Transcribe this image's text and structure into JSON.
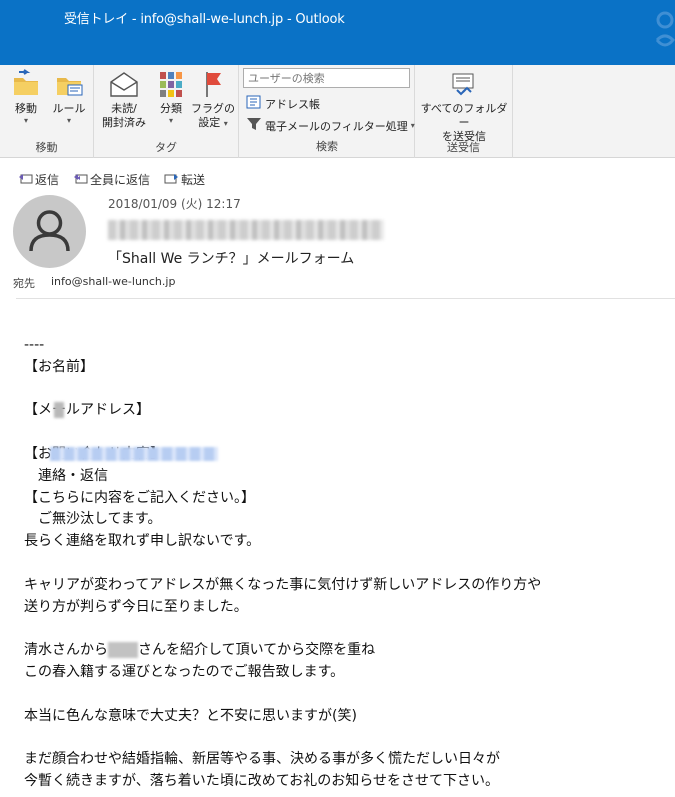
{
  "window": {
    "title": "受信トレイ - info@shall-we-lunch.jp  -  Outlook"
  },
  "ribbon": {
    "groups": {
      "move": {
        "label": "移動",
        "buttons": {
          "move": "移動",
          "rules": "ルール"
        }
      },
      "tags": {
        "label": "タグ",
        "buttons": {
          "unread_read": [
            "未読/",
            "開封済み"
          ],
          "categorize": "分類",
          "followup": [
            "フラグの",
            "設定"
          ]
        }
      },
      "find": {
        "label": "検索",
        "search_placeholder": "ユーザーの検索",
        "address_book": "アドレス帳",
        "filter_email": "電子メールのフィルター処理"
      },
      "send_receive": {
        "label": "送受信",
        "buttons": {
          "all_folders": [
            "すべてのフォルダー",
            "を送受信"
          ]
        }
      }
    },
    "colors": {
      "accent": "#0a72c6",
      "flag": "#e04b3c"
    }
  },
  "message": {
    "actions": {
      "reply": "返信",
      "reply_all": "全員に返信",
      "forward": "転送"
    },
    "date": "2018/01/09 (火) 12:17",
    "subject": "「Shall We ランチ？」メールフォーム",
    "to_label": "宛先",
    "to_value": "info@shall-we-lunch.jp",
    "body_lines": [
      "----",
      "【お名前】",
      "",
      "【メールアドレス】",
      "",
      "【お問い合わせ内容】",
      "　連絡・返信",
      "【こちらに内容をご記入ください。】",
      "　ご無沙汰してます。",
      "長らく連絡を取れず申し訳ないです。",
      "",
      "キャリアが変わってアドレスが無くなった事に気付けず新しいアドレスの作り方や",
      "送り方が判らず今日に至りました。",
      "",
      "清水さんから",
      "この春入籍する運びとなったのでご報告致します。",
      "",
      "本当に色んな意味で大丈夫？と不安に思いますが(笑)",
      "",
      "まだ顔合わせや結婚指輪、新居等やる事、決める事が多く慌ただしい日々が",
      "今暫く続きますが、落ち着いた頃に改めてお礼のお知らせをさせて下さい。"
    ],
    "body_line14_suffix": "さんを紹介して頂いてから交際を重ね"
  }
}
